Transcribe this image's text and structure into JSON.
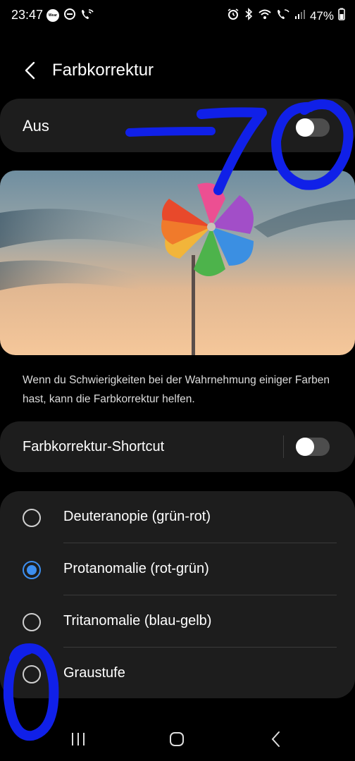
{
  "status_bar": {
    "time": "23:47",
    "wear_badge": "Wear",
    "battery": "47%",
    "left_icons": [
      "wear-icon",
      "dnd-icon",
      "wifi-call-icon"
    ],
    "right_icons": [
      "alarm-icon",
      "bluetooth-icon",
      "wifi-icon",
      "wifi-call-icon",
      "signal-icon"
    ]
  },
  "header": {
    "title": "Farbkorrektur"
  },
  "main_toggle": {
    "label": "Aus",
    "checked": false
  },
  "description": "Wenn du Schwierigkeiten bei der Wahrnehmung einiger Farben hast, kann die Farbkorrektur helfen.",
  "shortcut": {
    "label": "Farbkorrektur-Shortcut",
    "checked": false
  },
  "options": [
    {
      "label": "Deuteranopie (grün-rot)",
      "selected": false
    },
    {
      "label": "Protanomalie (rot-grün)",
      "selected": true
    },
    {
      "label": "Tritanomalie (blau-gelb)",
      "selected": false
    },
    {
      "label": "Graustufe",
      "selected": false
    }
  ],
  "annotations": {
    "handwritten_text": "-70 / 0",
    "color": "#1020e8"
  },
  "colors": {
    "accent": "#3d8ff0",
    "card": "#1d1d1d",
    "background": "#000000"
  }
}
